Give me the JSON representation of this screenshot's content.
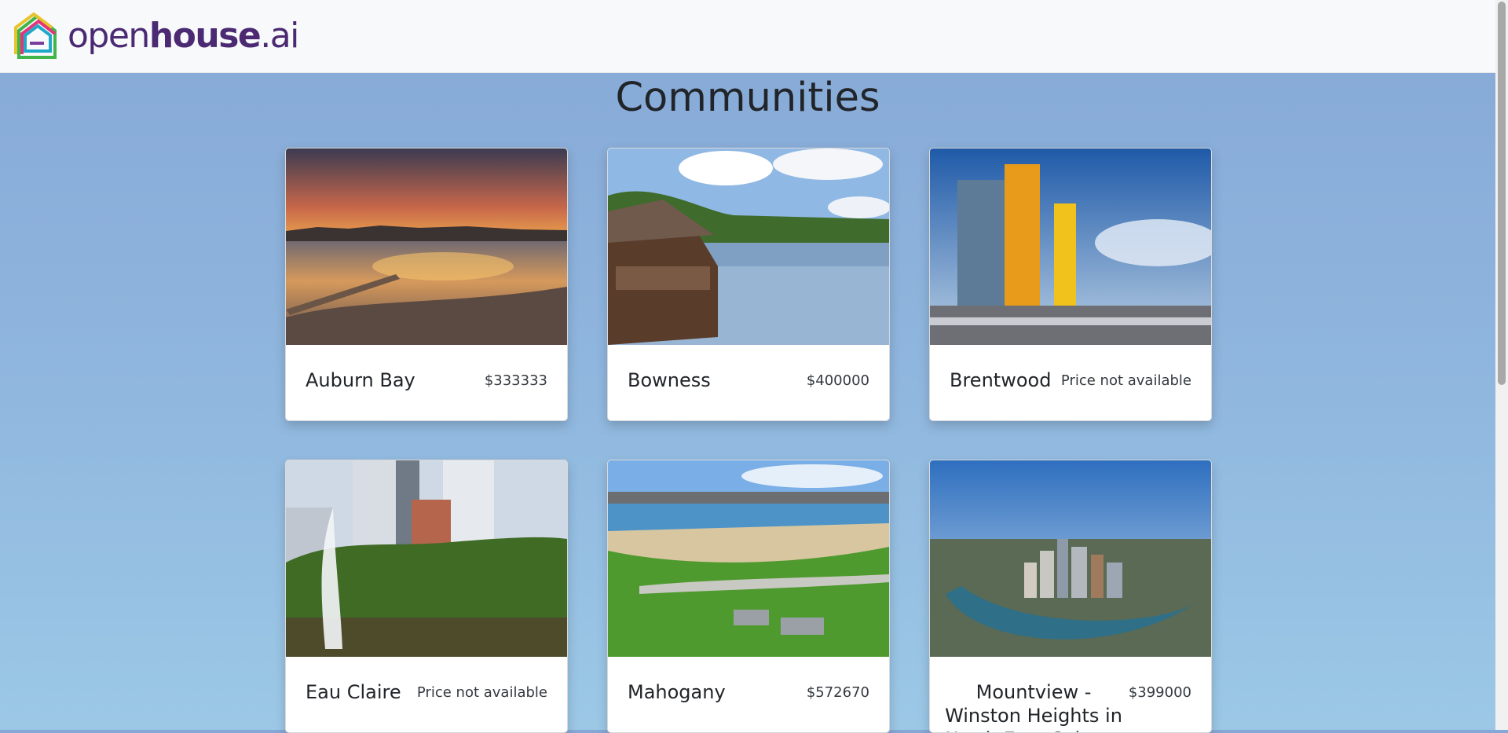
{
  "header": {
    "logo": {
      "text_light": "open",
      "text_bold": "house",
      "text_suffix": ".ai",
      "icon": "house-logo-icon"
    }
  },
  "page": {
    "title": "Communities"
  },
  "communities": [
    {
      "name": "Auburn Bay",
      "price": "$333333",
      "image": "sunset-lake-photo"
    },
    {
      "name": "Bowness",
      "price": "$400000",
      "image": "park-lagoon-photo"
    },
    {
      "name": "Brentwood",
      "price": "Price not available",
      "image": "tower-buildings-photo"
    },
    {
      "name": "Eau Claire",
      "price": "Price not available",
      "image": "fountain-downtown-photo"
    },
    {
      "name": "Mahogany",
      "price": "$572670",
      "image": "lake-park-photo"
    },
    {
      "name": "Mountview - Winston Heights in North East Calgary",
      "price": "$399000",
      "image": "city-aerial-photo"
    }
  ],
  "colors": {
    "brand": "#4b2a73",
    "background_top": "#86a8d6",
    "background_bottom": "#9cc8e6"
  }
}
